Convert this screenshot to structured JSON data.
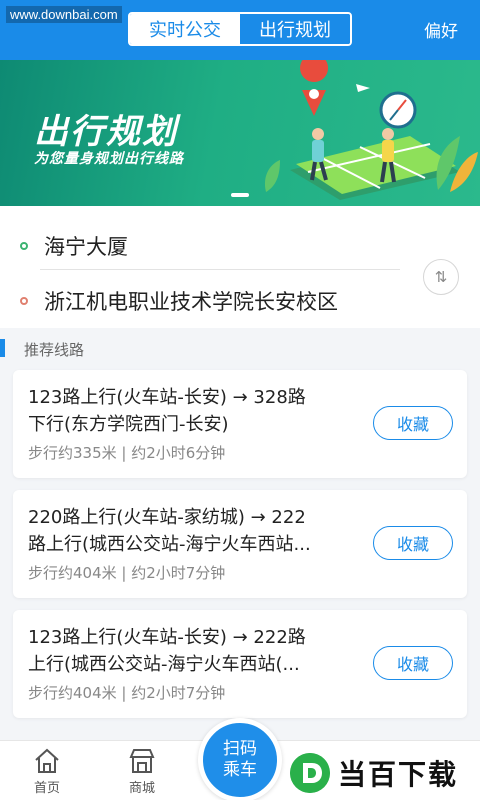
{
  "watermark_top": "www.downbai.com",
  "header": {
    "tabs": [
      {
        "label": "实时公交"
      },
      {
        "label": "出行规划"
      }
    ],
    "preference": "偏好"
  },
  "banner": {
    "title": "出行规划",
    "subtitle": "为您量身规划出行线路"
  },
  "locations": {
    "from": "海宁大厦",
    "to": "浙江机电职业技术学院长安校区",
    "swap_icon": "swap-icon"
  },
  "section_title": "推荐线路",
  "routes": [
    {
      "line1": "123路上行(火车站-长安) → 328路",
      "line2": "下行(东方学院西门-长安)",
      "meta": "步行约335米 | 约2小时6分钟",
      "button": "收藏"
    },
    {
      "line1": "220路上行(火车站-家纺城) → 222",
      "line2": "路上行(城西公交站-海宁火车西站...",
      "meta": "步行约404米 | 约2小时7分钟",
      "button": "收藏"
    },
    {
      "line1": "123路上行(火车站-长安) → 222路",
      "line2": "上行(城西公交站-海宁火车西站(...",
      "meta": "步行约404米 | 约2小时7分钟",
      "button": "收藏"
    }
  ],
  "bottom_nav": {
    "home": "首页",
    "mall": "商城",
    "scan_line1": "扫码",
    "scan_line2": "乘车"
  },
  "watermark_br": "当百下载",
  "colors": {
    "primary": "#1a8be8",
    "banner_green": "#1fae84",
    "from_dot": "#3cb371",
    "to_dot": "#e0806f"
  }
}
